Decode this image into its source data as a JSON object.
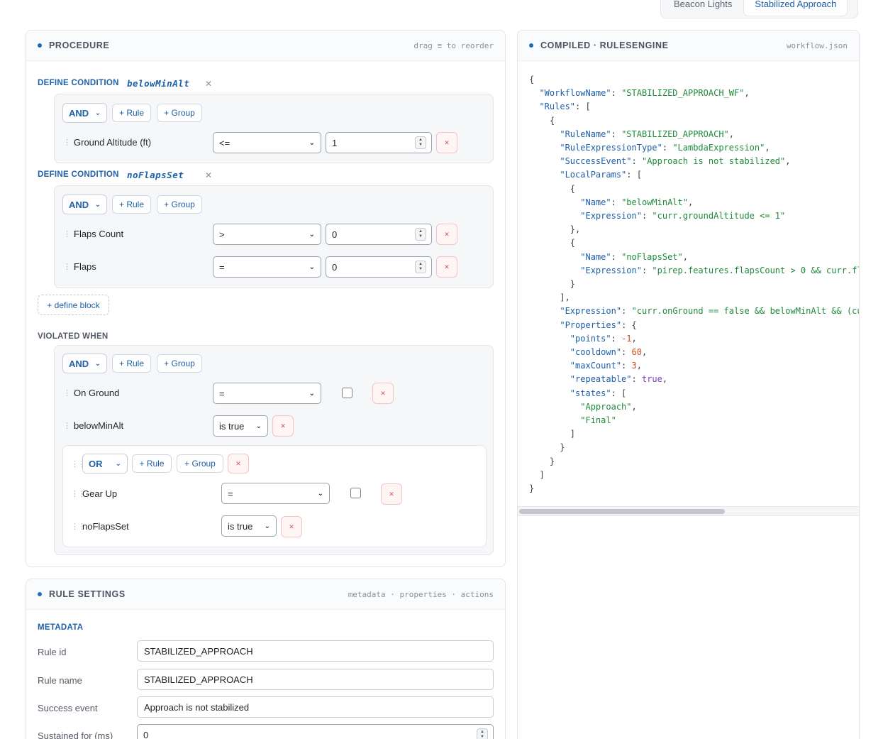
{
  "tabs": [
    {
      "label": "Beacon Lights",
      "active": false
    },
    {
      "label": "Stabilized Approach",
      "active": true
    }
  ],
  "procedure": {
    "title": "PROCEDURE",
    "hint": "drag ≡ to reorder",
    "conditions": [
      {
        "label": "DEFINE CONDITION",
        "name": "belowMinAlt",
        "combinator": "AND",
        "add_rule": "+ Rule",
        "add_group": "+ Group",
        "rules": [
          {
            "field": "Ground Altitude (ft)",
            "operator": "<=",
            "value": "1"
          }
        ]
      },
      {
        "label": "DEFINE CONDITION",
        "name": "noFlapsSet",
        "combinator": "AND",
        "add_rule": "+ Rule",
        "add_group": "+ Group",
        "rules": [
          {
            "field": "Flaps Count",
            "operator": ">",
            "value": "0"
          },
          {
            "field": "Flaps",
            "operator": "=",
            "value": "0"
          }
        ]
      }
    ],
    "define_block": "+ define block",
    "violated": {
      "label": "VIOLATED WHEN",
      "combinator": "AND",
      "add_rule": "+ Rule",
      "add_group": "+ Group",
      "rules": [
        {
          "field": "On Ground",
          "operator": "="
        },
        {
          "field": "belowMinAlt",
          "operator": "is true"
        }
      ],
      "subgroup": {
        "combinator": "OR",
        "add_rule": "+ Rule",
        "add_group": "+ Group",
        "rules": [
          {
            "field": "Gear Up",
            "operator": "="
          },
          {
            "field": "noFlapsSet",
            "operator": "is true"
          }
        ]
      }
    }
  },
  "settings": {
    "title": "RULE SETTINGS",
    "hint": "metadata · properties · actions",
    "metadata_label": "METADATA",
    "fields": [
      {
        "label": "Rule id",
        "value": "STABILIZED_APPROACH"
      },
      {
        "label": "Rule name",
        "value": "STABILIZED_APPROACH"
      },
      {
        "label": "Success event",
        "value": "Approach is not stabilized"
      },
      {
        "label": "Sustained for (ms)",
        "value": "0"
      }
    ]
  },
  "compiled": {
    "title": "COMPILED · RULESENGINE",
    "file": "workflow.json",
    "lines": [
      "{",
      "  \"WorkflowName\": \"STABILIZED_APPROACH_WF\",",
      "  \"Rules\": [",
      "    {",
      "      \"RuleName\": \"STABILIZED_APPROACH\",",
      "      \"RuleExpressionType\": \"LambdaExpression\",",
      "      \"SuccessEvent\": \"Approach is not stabilized\",",
      "      \"LocalParams\": [",
      "        {",
      "          \"Name\": \"belowMinAlt\",",
      "          \"Expression\": \"curr.groundAltitude <= 1\"",
      "        },",
      "        {",
      "          \"Name\": \"noFlapsSet\",",
      "          \"Expression\": \"pirep.features.flapsCount > 0 && curr.fl",
      "        }",
      "      ],",
      "      \"Expression\": \"curr.onGround == false && belowMinAlt && (cu",
      "      \"Properties\": {",
      "        \"points\": -1,",
      "        \"cooldown\": 60,",
      "        \"maxCount\": 3,",
      "        \"repeatable\": true,",
      "        \"states\": [",
      "          \"Approach\",",
      "          \"Final\"",
      "        ]",
      "      }",
      "    }",
      "  ]",
      "}"
    ]
  }
}
